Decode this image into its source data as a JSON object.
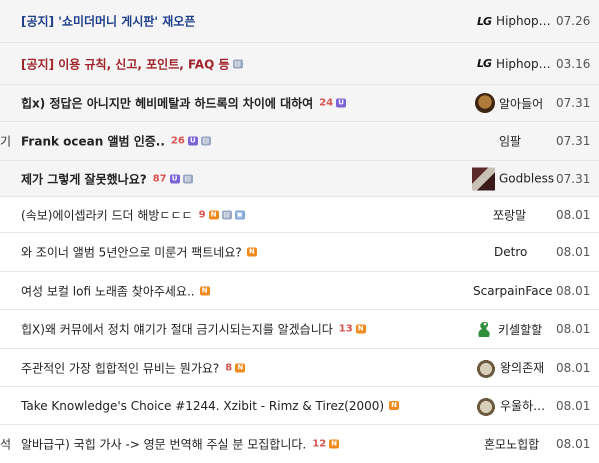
{
  "rows": [
    {
      "category": "",
      "title": "[공지] '쇼미더머니 게시판' 재오픈",
      "comments": "",
      "badges": [],
      "author": "Hiphop…",
      "author_prefix": "LG",
      "date": "07.26"
    },
    {
      "category": "",
      "title": "[공지] 이용 규칙, 신고, 포인트, FAQ 등",
      "comments": "",
      "badges": [
        "file"
      ],
      "author": "Hiphop…",
      "author_prefix": "LG",
      "date": "03.16"
    },
    {
      "category": "",
      "title": "힙x) 정답은 아니지만 헤비메탈과 하드록의 차이에 대하여",
      "comments": "24",
      "badges": [
        "U"
      ],
      "author": "알아들어",
      "date": "07.31"
    },
    {
      "category": "기",
      "title": "Frank ocean 앨범 인증..",
      "comments": "26",
      "badges": [
        "U",
        "file"
      ],
      "author": "임팔",
      "date": "07.31"
    },
    {
      "category": "",
      "title": "제가 그렇게 잘못했나요?",
      "comments": "87",
      "badges": [
        "U",
        "file"
      ],
      "author": "Godbless",
      "date": "07.31"
    },
    {
      "category": "",
      "title": "(속보)에이셉라키 드더 해방ㄷㄷㄷ",
      "comments": "9",
      "badges": [
        "N",
        "file",
        "img"
      ],
      "author": "쪼랑말",
      "date": "08.01"
    },
    {
      "category": "",
      "title": "와 조이너 앨범 5년안으로 미룬거 팩트네요?",
      "comments": "",
      "badges": [
        "N"
      ],
      "author": "Detro",
      "date": "08.01"
    },
    {
      "category": "",
      "title": "여성 보컬 lofi 노래좀 찾아주세요..",
      "comments": "",
      "badges": [
        "N"
      ],
      "author": "ScarpainFace",
      "date": "08.01"
    },
    {
      "category": "",
      "title": "힙X)왜 커뮤에서 정치 얘기가 절대 금기시되는지를 알겠습니다",
      "comments": "13",
      "badges": [
        "N"
      ],
      "author": "키셀할할",
      "date": "08.01"
    },
    {
      "category": "",
      "title": "주관적인 가장 힙합적인 뮤비는 뭔가요?",
      "comments": "8",
      "badges": [
        "N"
      ],
      "author": "왕의존재",
      "date": "08.01"
    },
    {
      "category": "",
      "title": "Take Knowledge's Choice #1244. Xzibit - Rimz & Tirez(2000)",
      "comments": "",
      "badges": [
        "N"
      ],
      "author": "우울하…",
      "date": "08.01"
    },
    {
      "category": "석",
      "title": "알바급구) 국힙 가사 -> 영문 번역해 주실 분 모집합니다.",
      "comments": "12",
      "badges": [
        "N"
      ],
      "author": "혼모노힙합",
      "date": "08.01"
    }
  ]
}
